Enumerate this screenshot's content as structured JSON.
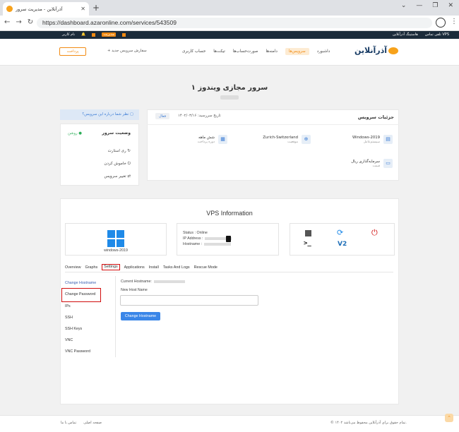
{
  "browser": {
    "tab_title": "آذرآنلاین - مدیریت سرور",
    "url": "https://dashboard.azaronline.com/services/543509"
  },
  "topbar": {
    "vps_link": "تلفن تماس VPS",
    "hosting": "هاستینگ آذرآنلاین",
    "lang": "نام کاربر",
    "balance": "مدیریت",
    "notif_count": "0"
  },
  "header": {
    "logo_text": "آذرآنلاین",
    "nav": [
      "داشبورد",
      "سرویس‌ها",
      "دامنه‌ها",
      "صورت‌حساب‌ها",
      "تیکت‌ها",
      "حساب کاربری"
    ],
    "new_service_btn": "+ سفارش سرویس جدید",
    "pay_btn": "پرداخت"
  },
  "page": {
    "title": "۱ سرور مجازی ویندوز"
  },
  "service_details": {
    "title": "جزئیات سرویس",
    "due_date": "تاریخ سررسید: ۱۴۰۲/۰۳/۱۶",
    "active": "فعال",
    "os_value": "Windows-2019",
    "os_label": "سیستم‌عامل",
    "location_value": "Zurich-Switzerland",
    "location_label": "موقعیت",
    "plan_value": "شش ماهه",
    "plan_label": "دوره پرداخت",
    "price_value": "سرمایه‌گذاری ریال",
    "price_label": "قیمت"
  },
  "server_status": {
    "help": "نظر شما درباره این سرویس؟",
    "title": "وضعیت سرور",
    "online": "روشن",
    "actions": [
      "ری استارت",
      "خاموش کردن",
      "تغییر سرویس"
    ]
  },
  "vps": {
    "title": "VPS Information",
    "os_name": "windows-2019",
    "status_label": "Status :",
    "status_value": "Online",
    "ip_label": "IP Address :",
    "hostname_label": "Hostname :",
    "tabs": [
      "Overview",
      "Graphs",
      "Settings",
      "Applications",
      "Install",
      "Tasks And Logs",
      "Rescue Mode"
    ],
    "side_menu": [
      "Change Hostname",
      "Change Password",
      "IPs",
      "SSH",
      "SSH Keys",
      "VNC",
      "VNC Password"
    ],
    "current_hostname_label": "Current Hostname:",
    "new_host_label": "New Host Name",
    "new_host_value": "",
    "change_btn": "Change Hostname"
  },
  "footer": {
    "copyright": "© ۱۴۰۲ تمام حقوق برای آذرآنلاین محفوظ می‌باشد.",
    "links": [
      "صفحه اصلی",
      "تماس با ما"
    ]
  },
  "colors": {
    "accent": "#f28b13",
    "primary": "#3a86e8",
    "highlight": "#d10d0d",
    "dark": "#1b2b3a"
  }
}
